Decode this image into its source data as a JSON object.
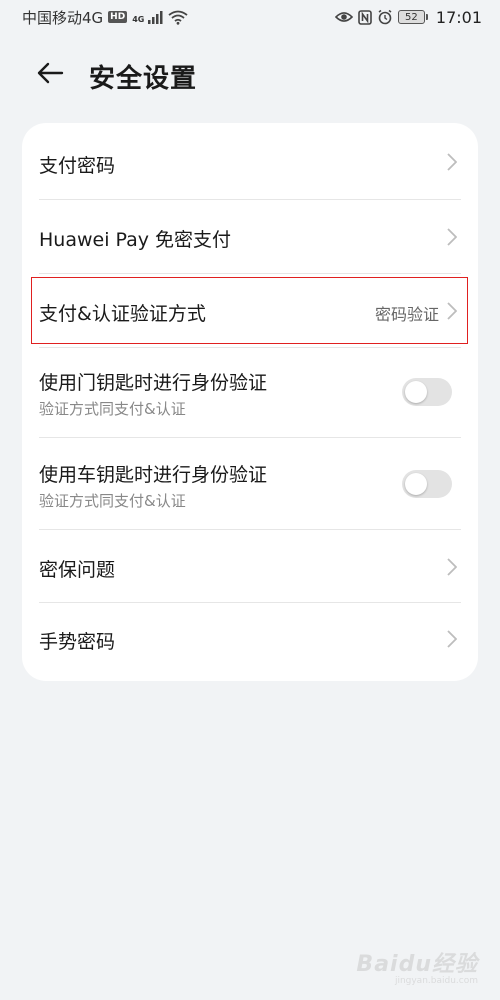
{
  "status_bar": {
    "carrier": "中国移动4G",
    "hd_badge": "HD",
    "signal_label": "4G",
    "battery": "52",
    "time": "17:01"
  },
  "header": {
    "title": "安全设置"
  },
  "settings": {
    "payment_password": {
      "label": "支付密码"
    },
    "huawei_pay": {
      "label": "Huawei Pay 免密支付"
    },
    "auth_method": {
      "label": "支付&认证验证方式",
      "value": "密码验证"
    },
    "door_key": {
      "label": "使用门钥匙时进行身份验证",
      "sublabel": "验证方式同支付&认证",
      "enabled": false
    },
    "car_key": {
      "label": "使用车钥匙时进行身份验证",
      "sublabel": "验证方式同支付&认证",
      "enabled": false
    },
    "security_question": {
      "label": "密保问题"
    },
    "gesture_password": {
      "label": "手势密码"
    }
  },
  "watermark": {
    "main": "Baidu经验",
    "sub": "jingyan.baidu.com"
  },
  "colors": {
    "background": "#f1f3f5",
    "card": "#ffffff",
    "highlight": "#e02020"
  }
}
